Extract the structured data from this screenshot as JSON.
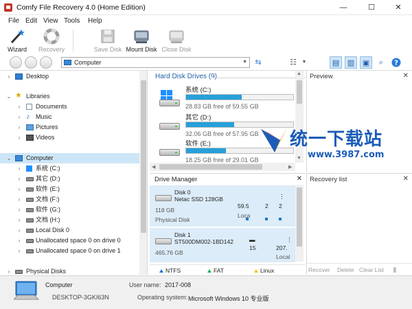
{
  "window": {
    "title": "Comfy File Recovery 4.0 (Home Edition)",
    "minimize": "—",
    "maximize": "☐",
    "close": "✕"
  },
  "menu": [
    "File",
    "Edit",
    "View",
    "Tools",
    "Help"
  ],
  "toolbar": {
    "wizard": "Wizard",
    "recovery": "Recovery",
    "save_disk": "Save Disk",
    "mount_disk": "Mount Disk",
    "close_disk": "Close Disk"
  },
  "address": {
    "value": "Computer"
  },
  "tree": {
    "desktop": "Desktop",
    "libraries": "Libraries",
    "documents": "Documents",
    "music": "Music",
    "pictures": "Pictures",
    "videos": "Videos",
    "computer": "Computer",
    "items": [
      "系统 (C:)",
      "其它 (D:)",
      "软件 (E:)",
      "文档 (F:)",
      "软件 (G:)",
      "文档 (H:)",
      "Local Disk 0",
      "Unallocated space 0 on drive 0",
      "Unallocated space 0 on drive 1"
    ],
    "physical_disks": "Physical Disks"
  },
  "hdd": {
    "title": "Hard Disk Drives (9)",
    "drives": [
      {
        "name": "系统 (C:)",
        "free": "28.83 GB free of 59.55 GB",
        "used": 0.52
      },
      {
        "name": "其它 (D:)",
        "free": "32.06 GB free of 57.95 GB",
        "used": 0.45
      },
      {
        "name": "软件 (E:)",
        "free": "18.25 GB free of 29.01 GB",
        "used": 0.37
      }
    ]
  },
  "preview": {
    "title": "Preview",
    "close": "✕"
  },
  "watermark": {
    "cn": "统一下载站",
    "url": "www.3987.com"
  },
  "drive_manager": {
    "title": "Drive Manager",
    "close": "✕",
    "disks": [
      {
        "name": "Disk 0",
        "model": "Netac SSD 128GB",
        "size": "118 GB",
        "kind": "Physical Disk",
        "c1": "59.5",
        "c1b": "Loca",
        "c2": "2",
        "c3": "2"
      },
      {
        "name": "Disk 1",
        "model": "ST500DM002-1BD142",
        "size": "465.76 GB",
        "c1": "15",
        "c2": "207.",
        "c2b": "Local"
      }
    ],
    "legend": [
      "NTFS",
      "FAT",
      "Linux"
    ]
  },
  "recovery_list": {
    "title": "Recovery list",
    "close": "✕",
    "recover": "Recover",
    "delete": "Delete",
    "clear_list": "Clear List"
  },
  "status": {
    "name": "Computer",
    "host": "DESKTOP-3GKI63N",
    "user_label": "User name:",
    "user": "2017-008",
    "os_label": "Operating system:",
    "os": "Microsoft Windows 10 专业版"
  },
  "colors": {
    "accent": "#26a0da",
    "selection": "#cde6f7",
    "panel_title": "#1f5fa8",
    "watermark": "#1c5cb8"
  }
}
